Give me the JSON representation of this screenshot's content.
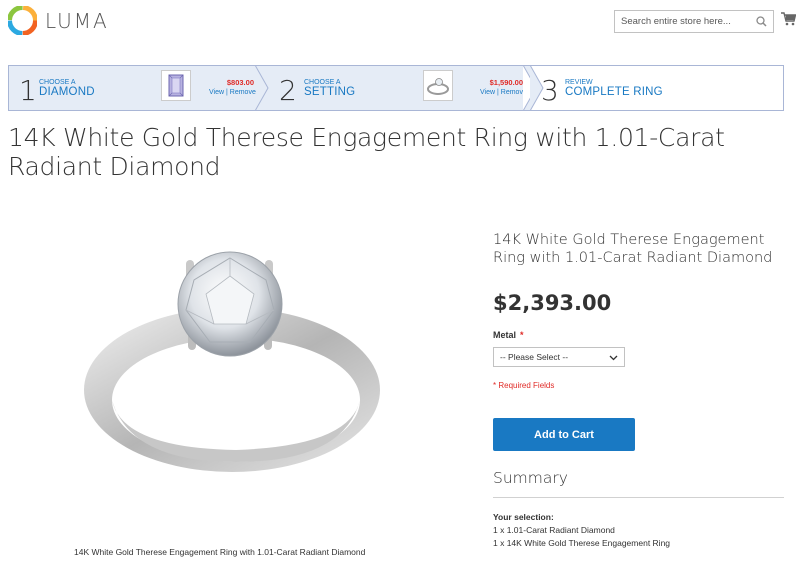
{
  "header": {
    "brand": "LUMA",
    "search_placeholder": "Search entire store here..."
  },
  "steps": [
    {
      "number": "1",
      "small": "CHOOSE A",
      "big": "DIAMOND",
      "price": "$803.00",
      "view": "View",
      "remove": "Remove"
    },
    {
      "number": "2",
      "small": "CHOOSE A",
      "big": "SETTING",
      "price": "$1,590.00",
      "view": "View",
      "remove": "Remove"
    },
    {
      "number": "3",
      "small": "REVIEW",
      "big": "COMPLETE RING"
    }
  ],
  "product": {
    "page_title": "14K White Gold Therese Engagement Ring with 1.01-Carat Radiant Diamond",
    "info_title": "14K White Gold Therese Engagement Ring with 1.01-Carat Radiant Diamond",
    "image_caption": "14K White Gold Therese Engagement Ring with 1.01-Carat Radiant Diamond",
    "price": "$2,393.00",
    "metal_label": "Metal",
    "required_marker": "*",
    "metal_selected": "-- Please Select --",
    "required_note": "* Required Fields",
    "add_to_cart": "Add to Cart"
  },
  "summary": {
    "title": "Summary",
    "selection_label": "Your selection:",
    "lines": [
      "1 x 1.01-Carat Radiant Diamond",
      "1 x 14K White Gold Therese Engagement Ring"
    ]
  },
  "colors": {
    "accent": "#1979c3",
    "price_red": "#e02b27",
    "steps_bg": "#e5ecf6"
  }
}
